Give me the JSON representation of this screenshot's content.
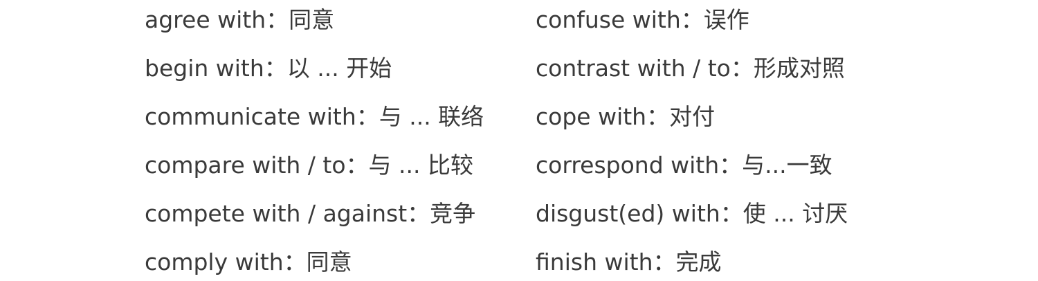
{
  "left_column": [
    "agree with：同意",
    "begin with：以 ... 开始",
    "communicate with：与 ... 联络",
    "compare with / to：与 ... 比较",
    "compete with / against：竞争",
    "comply with：同意"
  ],
  "right_column": [
    "confuse with：误作",
    "contrast with / to：形成对照",
    "cope with：对付",
    "correspond with：与...一致",
    "disgust(ed) with：使 ... 讨厌",
    "finish with：完成"
  ]
}
